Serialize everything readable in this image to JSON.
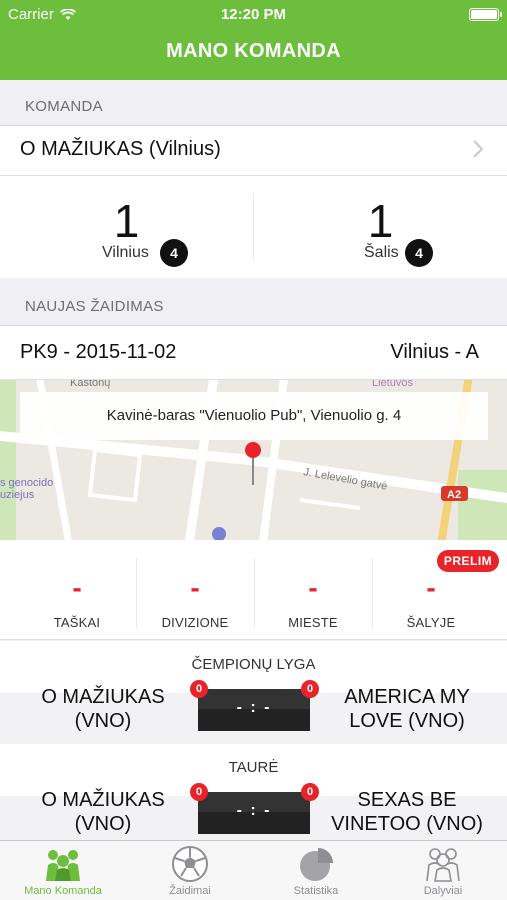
{
  "status_bar": {
    "carrier": "Carrier",
    "time": "12:20 PM"
  },
  "nav": {
    "title": "MANO KOMANDA"
  },
  "team_section": {
    "header": "KOMANDA",
    "team_name": "O MAŽIUKAS (Vilnius)",
    "ranks": [
      {
        "value": "1",
        "label": "Vilnius",
        "badge": "4"
      },
      {
        "value": "1",
        "label": "Šalis",
        "badge": "4"
      }
    ]
  },
  "new_game": {
    "header": "NAUJAS ŽAIDIMAS",
    "code_date": "PK9 - 2015-11-02",
    "league": "Vilnius - A",
    "venue": "Kavinė-baras \"Vienuolio Pub\", Vienuolio g. 4",
    "map_labels": {
      "street1": "Kaštonų",
      "street2": "J. Lelevelio gatvė",
      "poi": "Lietuvos Nacionalinis",
      "museum": "s genocido",
      "museum2": "uziejus",
      "road": "A2"
    },
    "stats": [
      {
        "value": "-",
        "label": "TAŠKAI"
      },
      {
        "value": "-",
        "label": "DIVIZIONE"
      },
      {
        "value": "-",
        "label": "MIESTE"
      },
      {
        "value": "-",
        "label": "ŠALYJE"
      }
    ],
    "prelim_badge": "PRELIM"
  },
  "matches": [
    {
      "title": "ČEMPIONŲ LYGA",
      "home": "O MAŽIUKAS (VNO)",
      "away": "AMERICA MY LOVE (VNO)",
      "score": "- : -",
      "home_badge": "0",
      "away_badge": "0"
    },
    {
      "title": "TAURĖ",
      "home": "O MAŽIUKAS (VNO)",
      "away": "SEXAS BE VINETOO (VNO)",
      "score": "- : -",
      "home_badge": "0",
      "away_badge": "0"
    }
  ],
  "tabs": [
    {
      "label": "Mano Komanda",
      "icon": "team-icon",
      "active": true
    },
    {
      "label": "Žaidimai",
      "icon": "ball-icon",
      "active": false
    },
    {
      "label": "Statistika",
      "icon": "pie-chart-icon",
      "active": false
    },
    {
      "label": "Dalyviai",
      "icon": "players-icon",
      "active": false
    }
  ],
  "colors": {
    "accent": "#6cbe3c",
    "alert": "#e8232a",
    "inactive": "#8e8e93"
  }
}
